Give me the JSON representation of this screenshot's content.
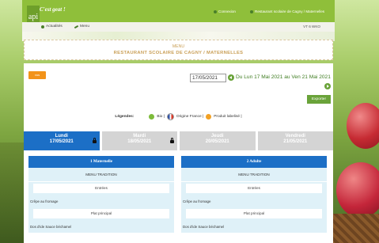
{
  "header": {
    "logo_text": "api",
    "slogan": "C'est geat !",
    "links": [
      "Connexion",
      "Restaurant scolaire de Cagny / Maternelles"
    ],
    "nav": [
      "Actualités",
      "Menu"
    ],
    "right_text": "VT 6 WKO"
  },
  "title": {
    "line1": "MENU",
    "line2": "RESTAURANT SCOLAIRE DE CAGNY / MATERNELLES"
  },
  "toolbar": {
    "orange_label": "vus",
    "date_value": "17/05/2021",
    "range_text": "Du Lun 17 Mai 2021 au Ven 21 Mai 2021",
    "export_label": "Exporter"
  },
  "legend": {
    "label": "Légendes:",
    "items": [
      "Bio |",
      "Origine France |",
      "Produit labelisé |"
    ]
  },
  "days": [
    {
      "name": "Lundi",
      "date": "17/05/2021",
      "active": true,
      "locked": true
    },
    {
      "name": "Mardi",
      "date": "18/05/2021",
      "active": false,
      "locked": true
    },
    {
      "name": "Jeudi",
      "date": "20/05/2021",
      "active": false,
      "locked": false
    },
    {
      "name": "Vendredi",
      "date": "21/05/2021",
      "active": false,
      "locked": false
    }
  ],
  "columns": [
    {
      "title": "1 Maternelle",
      "subtitle": "MENU TRADITION",
      "sections": [
        {
          "category": "Entrées",
          "dish": "Crêpe au fromage"
        },
        {
          "category": "Plat principal",
          "dish": "Dos d'ide Sauce béchamel"
        }
      ]
    },
    {
      "title": "2 Adulte",
      "subtitle": "MENU TRADITION",
      "sections": [
        {
          "category": "Entrées",
          "dish": "Crêpe au fromage"
        },
        {
          "category": "Plat principal",
          "dish": "Dos d'ide Sauce béchamel"
        }
      ]
    }
  ],
  "colors": {
    "accent_green": "#6aa33a",
    "tab_blue": "#1c6fc6",
    "orange": "#f2931a",
    "title_gold": "#caa058"
  }
}
